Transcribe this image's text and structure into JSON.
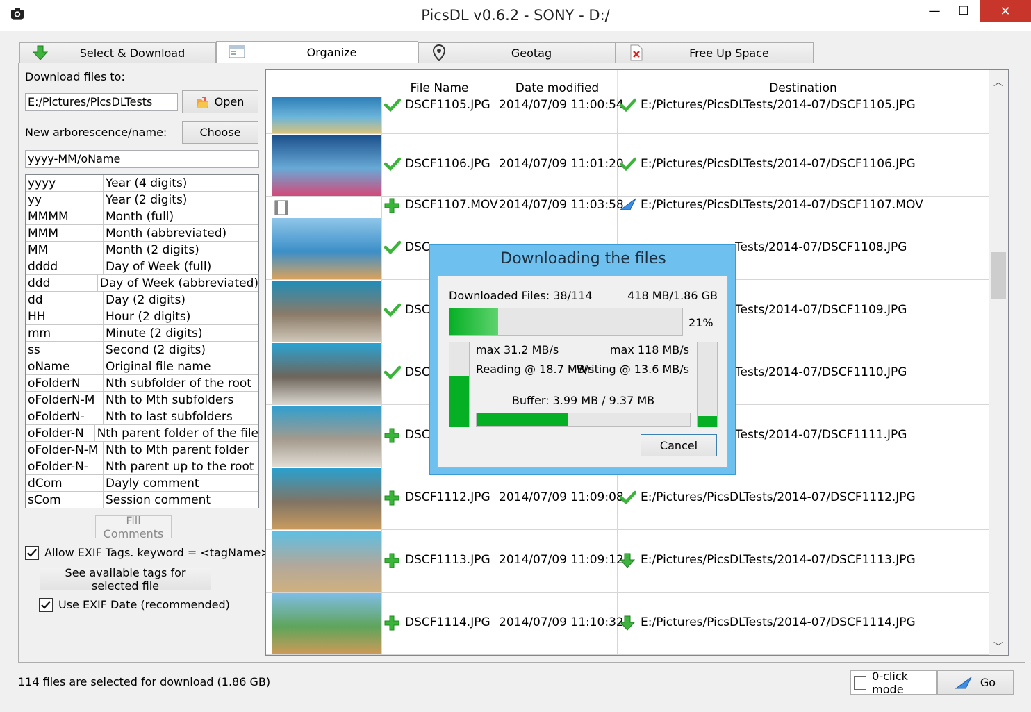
{
  "window": {
    "title": "PicsDL v0.6.2 - SONY - D:/",
    "minimize": "—",
    "maximize": "☐",
    "close": "✕"
  },
  "tabs": [
    {
      "label": "Select & Download",
      "icon": "green-download-arrow-icon"
    },
    {
      "label": "Organize",
      "icon": "window-icon",
      "active": true
    },
    {
      "label": "Geotag",
      "icon": "map-pin-icon"
    },
    {
      "label": "Free Up Space",
      "icon": "delete-file-icon"
    }
  ],
  "left": {
    "download_to_label": "Download files to:",
    "download_path": "E:/Pictures/PicsDLTests",
    "open_label": "Open",
    "arbo_label": "New arborescence/name:",
    "choose_label": "Choose",
    "pattern": "yyyy-MM/oName",
    "formats": [
      {
        "k": "yyyy",
        "v": "Year (4 digits)"
      },
      {
        "k": "yy",
        "v": "Year (2 digits)"
      },
      {
        "k": "MMMM",
        "v": "Month (full)"
      },
      {
        "k": "MMM",
        "v": "Month (abbreviated)"
      },
      {
        "k": "MM",
        "v": "Month (2 digits)"
      },
      {
        "k": "dddd",
        "v": "Day of Week (full)"
      },
      {
        "k": "ddd",
        "v": "Day of Week (abbreviated)"
      },
      {
        "k": "dd",
        "v": "Day (2 digits)"
      },
      {
        "k": "HH",
        "v": "Hour (2 digits)"
      },
      {
        "k": "mm",
        "v": "Minute (2 digits)"
      },
      {
        "k": "ss",
        "v": "Second (2 digits)"
      },
      {
        "k": "oName",
        "v": "Original file name"
      },
      {
        "k": "oFolderN",
        "v": "Nth subfolder of the root"
      },
      {
        "k": "oFolderN-M",
        "v": "Nth to Mth subfolders"
      },
      {
        "k": "oFolderN-",
        "v": "Nth to last subfolders"
      },
      {
        "k": "oFolder-N",
        "v": "Nth parent folder of the file"
      },
      {
        "k": "oFolder-N-M",
        "v": "Nth to Mth parent folder"
      },
      {
        "k": "oFolder-N-",
        "v": "Nth parent up to the root"
      },
      {
        "k": "dCom",
        "v": "Dayly comment"
      },
      {
        "k": "sCom",
        "v": "Session comment"
      }
    ],
    "fill_comments": "Fill Comments",
    "allow_exif_label": "Allow EXIF Tags. keyword = <tagName>",
    "allow_exif_checked": true,
    "see_tags_label": "See available tags for selected file",
    "use_exif_date_label": "Use EXIF Date (recommended)",
    "use_exif_date_checked": true
  },
  "grid": {
    "headers": {
      "name": "File Name",
      "date": "Date modified",
      "dest": "Destination"
    },
    "rows": [
      {
        "name": "DSCF1105.JPG",
        "date": "2014/07/09 11:00:54",
        "dest": "E:/Pictures/PicsDLTests/2014-07/DSCF1105.JPG",
        "status": "check",
        "dest_status": "check"
      },
      {
        "name": "DSCF1106.JPG",
        "date": "2014/07/09 11:01:20",
        "dest": "E:/Pictures/PicsDLTests/2014-07/DSCF1106.JPG",
        "status": "check",
        "dest_status": "check"
      },
      {
        "name": "DSCF1107.MOV",
        "date": "2014/07/09 11:03:58",
        "dest": "E:/Pictures/PicsDLTests/2014-07/DSCF1107.MOV",
        "status": "plus",
        "dest_status": "arrow"
      },
      {
        "name": "DSC",
        "date": "",
        "dest": "Tests/2014-07/DSCF1108.JPG",
        "status": "check",
        "dest_status": ""
      },
      {
        "name": "DSC",
        "date": "",
        "dest": "Tests/2014-07/DSCF1109.JPG",
        "status": "check",
        "dest_status": ""
      },
      {
        "name": "DSC",
        "date": "",
        "dest": "Tests/2014-07/DSCF1110.JPG",
        "status": "check",
        "dest_status": ""
      },
      {
        "name": "DSC",
        "date": "",
        "dest": "Tests/2014-07/DSCF1111.JPG",
        "status": "plus",
        "dest_status": ""
      },
      {
        "name": "DSCF1112.JPG",
        "date": "2014/07/09 11:09:08",
        "dest": "E:/Pictures/PicsDLTests/2014-07/DSCF1112.JPG",
        "status": "plus",
        "dest_status": "check"
      },
      {
        "name": "DSCF1113.JPG",
        "date": "2014/07/09 11:09:12",
        "dest": "E:/Pictures/PicsDLTests/2014-07/DSCF1113.JPG",
        "status": "plus",
        "dest_status": "down"
      },
      {
        "name": "DSCF1114.JPG",
        "date": "2014/07/09 11:10:32",
        "dest": "E:/Pictures/PicsDLTests/2014-07/DSCF1114.JPG",
        "status": "plus",
        "dest_status": "down"
      }
    ]
  },
  "dialog": {
    "title": "Downloading the files",
    "downloaded_label": "Downloaded Files: 38/114",
    "size_label": "418 MB/1.86 GB",
    "progress": 0.21,
    "percent_label": "21%",
    "read_max": "max 31.2 MB/s",
    "write_max": "max 118 MB/s",
    "reading": "Reading @ 18.7 MB/s",
    "writing": "Writing @ 13.6 MB/s",
    "read_level": 0.6,
    "write_level": 0.12,
    "buffer_label": "Buffer: 3.99 MB / 9.37 MB",
    "buffer_fill": 0.426,
    "cancel": "Cancel"
  },
  "status": {
    "text": "114 files are selected for download (1.86 GB)",
    "zero_click": "0-click mode",
    "go": "Go"
  },
  "colors": {
    "progress_green": "#06b025",
    "dialog_border": "#6ec0ee",
    "check_green": "#3ab53a",
    "close_red": "#c7352b"
  }
}
